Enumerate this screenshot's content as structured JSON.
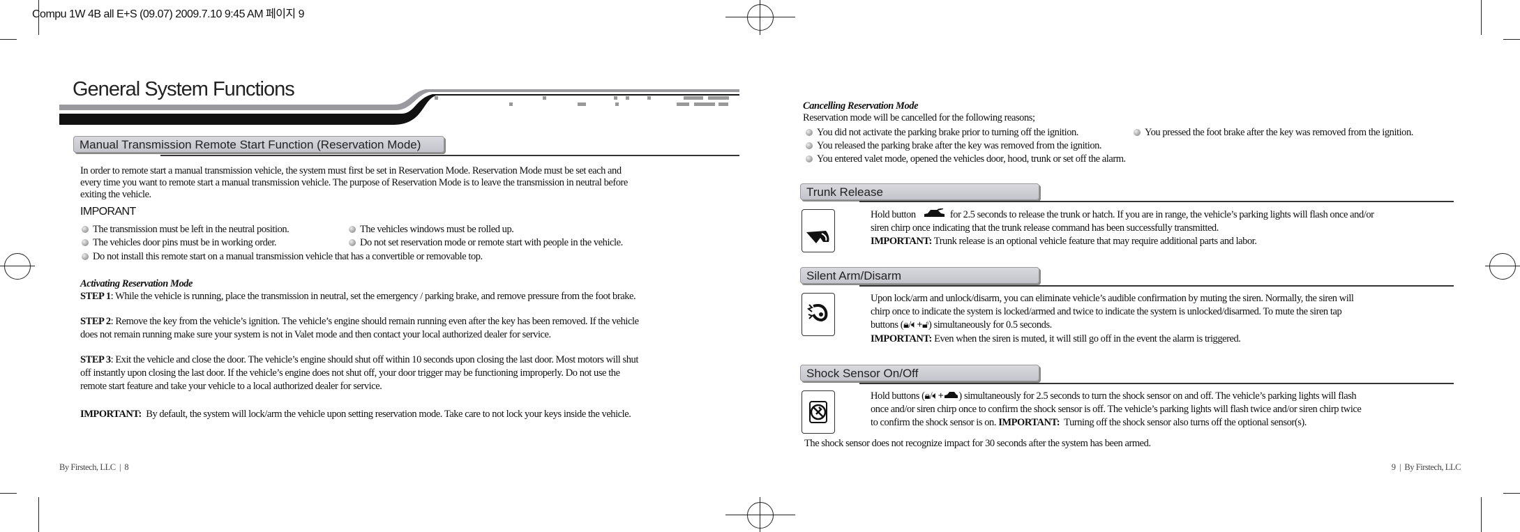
{
  "print_slug": "Compu 1W 4B all E+S (09.07)  2009.7.10 9:45 AM 페이지 9",
  "left": {
    "title": "General System Functions",
    "section": "Manual Transmission Remote Start Function (Reservation Mode)",
    "intro": [
      "In order to remote start a manual transmission vehicle, the system must first be set in Reservation Mode.  Reservation Mode must be set each and",
      "every time you want to remote start a manual transmission vehicle. The purpose of Reservation Mode is to leave the transmission in neutral before",
      "exiting the vehicle."
    ],
    "important_heading": "IMPORANT",
    "bullets": [
      "The transmission must be left in the neutral position.",
      "The vehicles windows must be rolled up.",
      "The vehicles door pins must be in working order.",
      "Do not set reservation mode or remote start with people in the vehicle.",
      "Do not install this remote start on a manual transmission vehicle that has a convertible or removable top."
    ],
    "activating_heading": "Activating Reservation Mode",
    "step1_label": "STEP 1",
    "step1": ": While the vehicle is running, place the transmission in neutral, set the emergency / parking brake, and remove pressure from the foot brake.",
    "step2_label": "STEP 2",
    "step2": [
      ": Remove the key from the vehicle’s ignition. The vehicle’s engine should remain running even after the key has been removed. If the vehicle",
      "does not remain running make sure your system is not in Valet mode and then contact your local authorized dealer for service."
    ],
    "step3_label": "STEP 3",
    "step3": [
      ": Exit the vehicle and close the door. The vehicle’s engine should shut off within 10 seconds upon closing the last door. Most motors will shut",
      "off instantly upon closing the last door. If the vehicle’s engine does not shut off, your door trigger may be functioning improperly. Do not use the",
      "remote start feature and take your vehicle to a local authorized dealer for service."
    ],
    "important_label": "IMPORTANT:",
    "important_text": "  By default, the system will lock/arm the vehicle upon setting reservation mode. Take care to not lock your keys inside the vehicle.",
    "footer": "By Firstech, LLC  |  8"
  },
  "right": {
    "cancel_heading": "Cancelling Reservation Mode",
    "cancel_intro": "Reservation mode will be cancelled for the following reasons;",
    "cancel_bullets": [
      "You did not activate the parking brake prior to turning off the ignition.",
      "You pressed the foot brake after the key was removed from the ignition.",
      "You released the parking brake after the key was removed from the ignition.",
      "You entered valet mode, opened the vehicles door, hood, trunk or set off the alarm."
    ],
    "trunk": {
      "title": "Trunk Release",
      "icon": "trunk-open-icon",
      "lines": [
        "Hold button",
        "for 2.5 seconds to release the trunk or hatch. If you are in range, the vehicle’s parking lights will flash once and/or",
        "siren chirp once indicating that the trunk release command has been successfully transmitted."
      ],
      "important_label": "IMPORTANT:",
      "important": " Trunk release is an optional vehicle feature that may require additional parts and labor."
    },
    "silent": {
      "title": "Silent Arm/Disarm",
      "icon": "muted-siren-icon",
      "lines": [
        "Upon lock/arm and unlock/disarm, you can eliminate vehicle’s audible confirmation by muting the siren. Normally, the siren will",
        "chirp once to indicate the system is locked/armed and twice to indicate the system is unlocked/disarmed. To mute the siren tap",
        "buttons (",
        "/",
        "+",
        ") simultaneously for 0.5 seconds."
      ],
      "important_label": "IMPORTANT:",
      "important": " Even when the siren is muted, it will still go off in the event the alarm is triggered."
    },
    "shock": {
      "title": "Shock Sensor On/Off",
      "icon": "shock-sensor-off-icon",
      "lines": [
        "Hold buttons (",
        "/",
        "+",
        ") simultaneously for 2.5 seconds to turn the shock sensor on and off. The vehicle’s parking lights will flash",
        "once and/or siren chirp once to confirm the shock sensor is off. The vehicle’s parking lights will flash twice and/or siren chirp twice",
        "to confirm the shock sensor is on. "
      ],
      "important_label": "IMPORTANT:",
      "important": "  Turning off the shock sensor also turns off the optional sensor(s).",
      "note": "The shock sensor does not recognize impact for 30 seconds after the system has been armed."
    },
    "footer": "9  |  By Firstech, LLC"
  }
}
